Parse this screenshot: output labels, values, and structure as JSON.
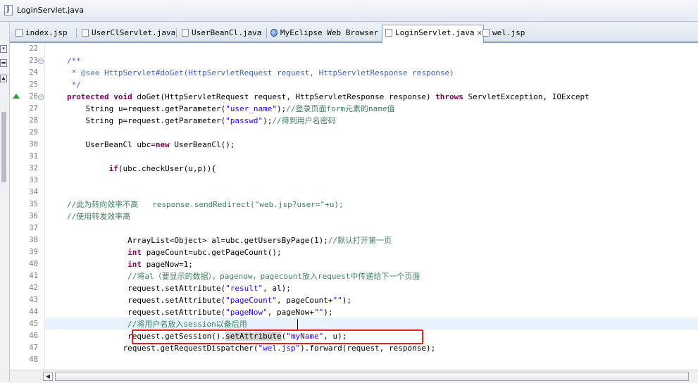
{
  "window": {
    "title": "LoginServlet.java"
  },
  "tabs": [
    {
      "label": "index.jsp",
      "icon": "jsp-file-icon"
    },
    {
      "label": "UserClServlet.java",
      "icon": "java-file-icon"
    },
    {
      "label": "UserBeanCl.java",
      "icon": "java-file-icon"
    },
    {
      "label": "MyEclipse Web Browser",
      "icon": "globe-icon"
    },
    {
      "label": "LoginServlet.java",
      "icon": "java-file-icon",
      "active": true,
      "close": "✕"
    },
    {
      "label": "wel.jsp",
      "icon": "jsp-file-icon"
    }
  ],
  "editor": {
    "line_numbers": [
      "22",
      "23",
      "24",
      "25",
      "26",
      "27",
      "28",
      "29",
      "30",
      "31",
      "32",
      "33",
      "34",
      "35",
      "36",
      "37",
      "38",
      "39",
      "40",
      "41",
      "42",
      "43",
      "44",
      "45",
      "46",
      "47",
      "48"
    ],
    "fold_markers": [
      "23",
      "26"
    ],
    "override_marker_line": "26",
    "current_line": "45",
    "highlighted_line": "46",
    "colors": {
      "keyword": "#7f0055",
      "string": "#2a00ff",
      "comment": "#3f7f5f",
      "javadoc": "#3f5fbf",
      "highlight_box": "#e2231a"
    }
  },
  "code": {
    "l23": "/**",
    "l24a": " * ",
    "l24b": "@see",
    "l24c": " HttpServlet#doGet(HttpServletRequest request, HttpServletResponse response)",
    "l25": " */",
    "l26a": "protected void",
    "l26b": " doGet(HttpServletRequest request, HttpServletResponse response) ",
    "l26c": "throws",
    "l26d": " ServletException, IOExcept",
    "l27a": "    String u=request.getParameter(",
    "l27b": "\"user_name\"",
    "l27c": ");",
    "l27d": "//登录页面form元素的name值",
    "l28a": "    String p=request.getParameter(",
    "l28b": "\"passwd\"",
    "l28c": ");",
    "l28d": "//得到用户名密码",
    "l30a": "    UserBeanCl ubc=",
    "l30b": "new",
    "l30c": " UserBeanCl();",
    "l32a": "         ",
    "l32b": "if",
    "l32c": "(ubc.checkUser(u,p)){",
    "l35": "//此为转向效率不高   response.sendRedirect(\"web.jsp?user=\"+u);",
    "l36": "//使用转发效率高",
    "l38a": "             ArrayList<Object> al=ubc.getUsersByPage(1);",
    "l38b": "//默认打开第一页",
    "l39a": "             ",
    "l39b": "int",
    "l39c": " pageCount=ubc.getPageCount();",
    "l40a": "             ",
    "l40b": "int",
    "l40c": " pageNow=1;",
    "l41": "             //将al（要显示的数据），pagenow，pagecount放入request中传递给下一个页面",
    "l42a": "             request.setAttribute(",
    "l42b": "\"result\"",
    "l42c": ", al);",
    "l43a": "             request.setAttribute(",
    "l43b": "\"pageCount\"",
    "l43c": ", pageCount+",
    "l43d": "\"\"",
    "l43e": ");",
    "l44a": "             request.setAttribute(",
    "l44b": "\"pageNow\"",
    "l44c": ", pageNow+",
    "l44d": "\"\"",
    "l44e": ");",
    "l45": "             //将用户名放入session以备后用",
    "l46a": "             request.getSession().",
    "l46b": "setAttribute",
    "l46c": "(",
    "l46d": "\"myName\"",
    "l46e": ", u);",
    "l47a": "            request.getRequestDispatcher(",
    "l47b": "\"wel.jsp\"",
    "l47c": ").forward(request, response);"
  }
}
